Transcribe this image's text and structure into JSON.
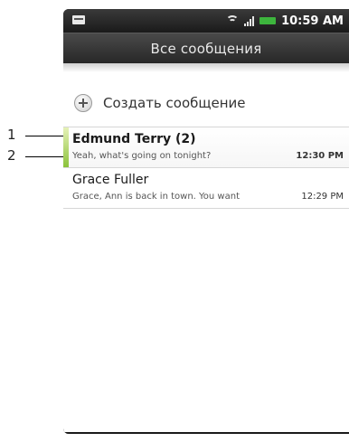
{
  "status_bar": {
    "time": "10:59 AM",
    "icons": [
      "notification-icon",
      "wifi-icon",
      "signal-icon",
      "battery-icon"
    ],
    "battery_color": "#3db53d"
  },
  "header": {
    "title": "Все сообщения"
  },
  "compose": {
    "label": "Создать сообщение",
    "icon": "plus-icon"
  },
  "conversations": [
    {
      "name": "Edmund Terry (2)",
      "preview": "Yeah, what's going on tonight?",
      "time": "12:30 PM",
      "unread": true,
      "unread_color": "#8bc23a"
    },
    {
      "name": "Grace Fuller",
      "preview": "Grace, Ann is back in town. You want",
      "time": "12:29 PM",
      "unread": false
    }
  ],
  "callouts": [
    "1",
    "2"
  ]
}
